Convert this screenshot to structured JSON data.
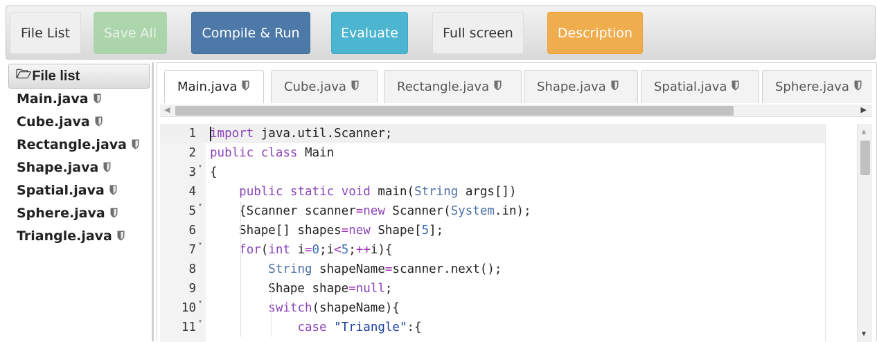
{
  "toolbar": {
    "file_list": "File List",
    "save_all": "Save All",
    "compile_run": "Compile & Run",
    "evaluate": "Evaluate",
    "full_screen": "Full screen",
    "description": "Description"
  },
  "sidebar": {
    "title": "File list",
    "files": [
      "Main.java",
      "Cube.java",
      "Rectangle.java",
      "Shape.java",
      "Spatial.java",
      "Sphere.java",
      "Triangle.java"
    ]
  },
  "tabs": [
    {
      "label": "Main.java",
      "active": true
    },
    {
      "label": "Cube.java",
      "active": false
    },
    {
      "label": "Rectangle.java",
      "active": false
    },
    {
      "label": "Shape.java",
      "active": false
    },
    {
      "label": "Spatial.java",
      "active": false
    },
    {
      "label": "Sphere.java",
      "active": false
    }
  ],
  "code": {
    "line_numbers": [
      "1",
      "2",
      "3",
      "4",
      "5",
      "6",
      "7",
      "8",
      "9",
      "10",
      "11"
    ],
    "lines": [
      "import java.util.Scanner;",
      "public class Main",
      "{",
      "    public static void main(String args[])",
      "    {Scanner scanner=new Scanner(System.in);",
      "    Shape[] shapes=new Shape[5];",
      "    for(int i=0;i<5;++i){",
      "        String shapeName=scanner.next();",
      "        Shape shape=null;",
      "        switch(shapeName){",
      "            case \"Triangle\":{"
    ]
  },
  "icons": {
    "file_badge": "shield-icon",
    "folder": "folder-open-icon",
    "fold": "fold-arrow-icon"
  },
  "colors": {
    "primary": "#4d79a8",
    "info": "#4cb5cf",
    "warning": "#f0ad4e",
    "success_disabled": "#a7d4a7",
    "keyword": "#8c44b8",
    "type": "#4b70a6"
  }
}
